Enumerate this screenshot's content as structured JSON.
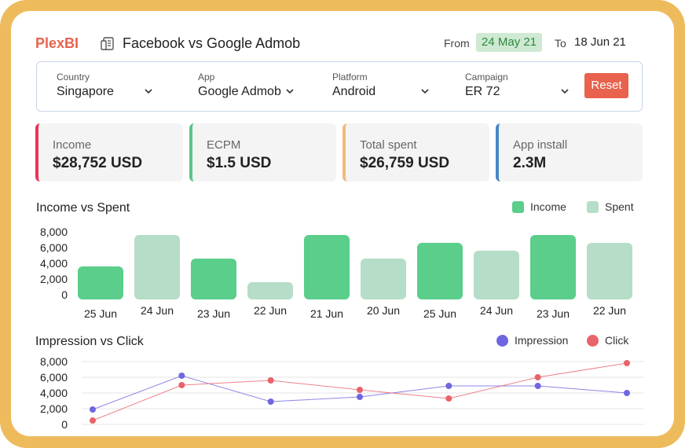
{
  "brand": "PlexBI",
  "title": "Facebook vs Google Admob",
  "date_range": {
    "from_label": "From",
    "from_value": "24 May 21",
    "to_label": "To",
    "to_value": "18 Jun 21"
  },
  "filters": [
    {
      "label": "Country",
      "value": "Singapore"
    },
    {
      "label": "App",
      "value": "Google Admob"
    },
    {
      "label": "Platform",
      "value": "Android"
    },
    {
      "label": "Campaign",
      "value": "ER 72"
    }
  ],
  "reset_label": "Reset",
  "kpis": [
    {
      "label": "Income",
      "value": "$28,752 USD",
      "color": "#e8345c"
    },
    {
      "label": "ECPM",
      "value": "$1.5 USD",
      "color": "#5bc48a"
    },
    {
      "label": "Total spent",
      "value": "$26,759 USD",
      "color": "#eebb7a"
    },
    {
      "label": "App install",
      "value": "2.3M",
      "color": "#4a86c5"
    }
  ],
  "income_chart": {
    "title": "Income vs Spent",
    "legend": [
      "Income",
      "Spent"
    ]
  },
  "impression_chart": {
    "title": "Impression vs Click",
    "legend": [
      "Impression",
      "Click"
    ]
  },
  "colors": {
    "income": "#5ace8a",
    "spent": "#b6ddc7",
    "impression": "#7066e0",
    "click": "#e8636a"
  },
  "chart_data": [
    {
      "type": "bar",
      "title": "Income vs Spent",
      "categories": [
        "25 Jun",
        "24 Jun",
        "23 Jun",
        "22 Jun",
        "21 Jun",
        "20 Jun",
        "25 Jun",
        "24 Jun",
        "23 Jun",
        "22 Jun"
      ],
      "series_by_bar": [
        "Income",
        "Spent",
        "Income",
        "Spent",
        "Income",
        "Spent",
        "Income",
        "Spent",
        "Income",
        "Spent"
      ],
      "values": [
        3600,
        7600,
        4600,
        1600,
        7600,
        4600,
        6600,
        5600,
        7600,
        6600
      ],
      "yticks": [
        "8,000",
        "6,000",
        "4,000",
        "2,000",
        "0"
      ],
      "ylim": [
        0,
        8000
      ],
      "legend_position": "top-right"
    },
    {
      "type": "line",
      "title": "Impression vs Click",
      "x_count": 7,
      "series": [
        {
          "name": "Impression",
          "values": [
            1900,
            6200,
            2900,
            3500,
            4900,
            4900,
            4000
          ]
        },
        {
          "name": "Click",
          "values": [
            500,
            5000,
            5600,
            4400,
            3300,
            6000,
            7800
          ]
        }
      ],
      "yticks": [
        "8,000",
        "6,000",
        "4,000",
        "2,000",
        "0"
      ],
      "ylim": [
        0,
        8000
      ],
      "grid": true,
      "legend_position": "top-right"
    }
  ]
}
